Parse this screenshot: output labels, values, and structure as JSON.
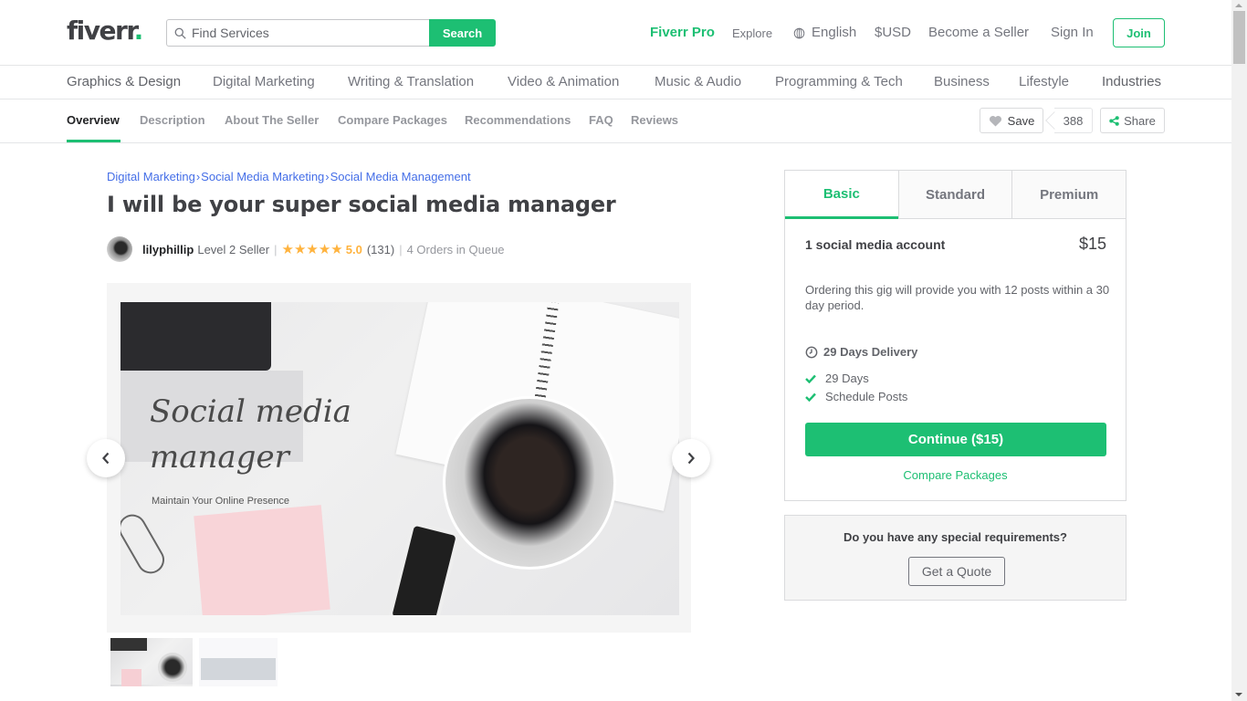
{
  "header": {
    "logo": "fiverr",
    "logo_dot": ".",
    "search_placeholder": "Find Services",
    "search_button": "Search",
    "nav": {
      "fiverr_pro": "Fiverr Pro",
      "explore": "Explore",
      "language": "English",
      "currency": "$USD",
      "become_seller": "Become a Seller",
      "sign_in": "Sign In",
      "join": "Join"
    }
  },
  "categories": [
    "Graphics & Design",
    "Digital Marketing",
    "Writing & Translation",
    "Video & Animation",
    "Music & Audio",
    "Programming & Tech",
    "Business",
    "Lifestyle",
    "Industries"
  ],
  "subnav": {
    "items": [
      "Overview",
      "Description",
      "About The Seller",
      "Compare Packages",
      "Recommendations",
      "FAQ",
      "Reviews"
    ],
    "active": "Overview",
    "save_label": "Save",
    "save_count": "388",
    "share_label": "Share"
  },
  "gig": {
    "breadcrumb": [
      "Digital Marketing",
      "Social Media Marketing",
      "Social Media Management"
    ],
    "breadcrumb_separator": "›",
    "title": "I will be your super social media manager",
    "seller": {
      "username": "lilyphillip",
      "level": "Level 2 Seller",
      "stars": "★★★★★",
      "rating": "5.0",
      "reviews": "(131)",
      "queue": "4 Orders in Queue"
    },
    "gallery": {
      "headline_line1": "Social media",
      "headline_line2": "manager",
      "tagline": "Maintain Your Online Presence",
      "thumbnail_count": 2
    }
  },
  "package": {
    "tabs": [
      "Basic",
      "Standard",
      "Premium"
    ],
    "active_tab": "Basic",
    "name": "1 social media account",
    "price": "$15",
    "description": "Ordering this gig will provide you with 12 posts within a 30 day period.",
    "delivery": "29 Days Delivery",
    "features": [
      "29 Days",
      "Schedule Posts"
    ],
    "continue_label": "Continue ($15)",
    "compare_label": "Compare Packages"
  },
  "quote": {
    "question": "Do you have any special requirements?",
    "button": "Get a Quote"
  },
  "colors": {
    "brand_green": "#1dbf73",
    "link_blue": "#446ee7",
    "star_yellow": "#ffb33e"
  }
}
